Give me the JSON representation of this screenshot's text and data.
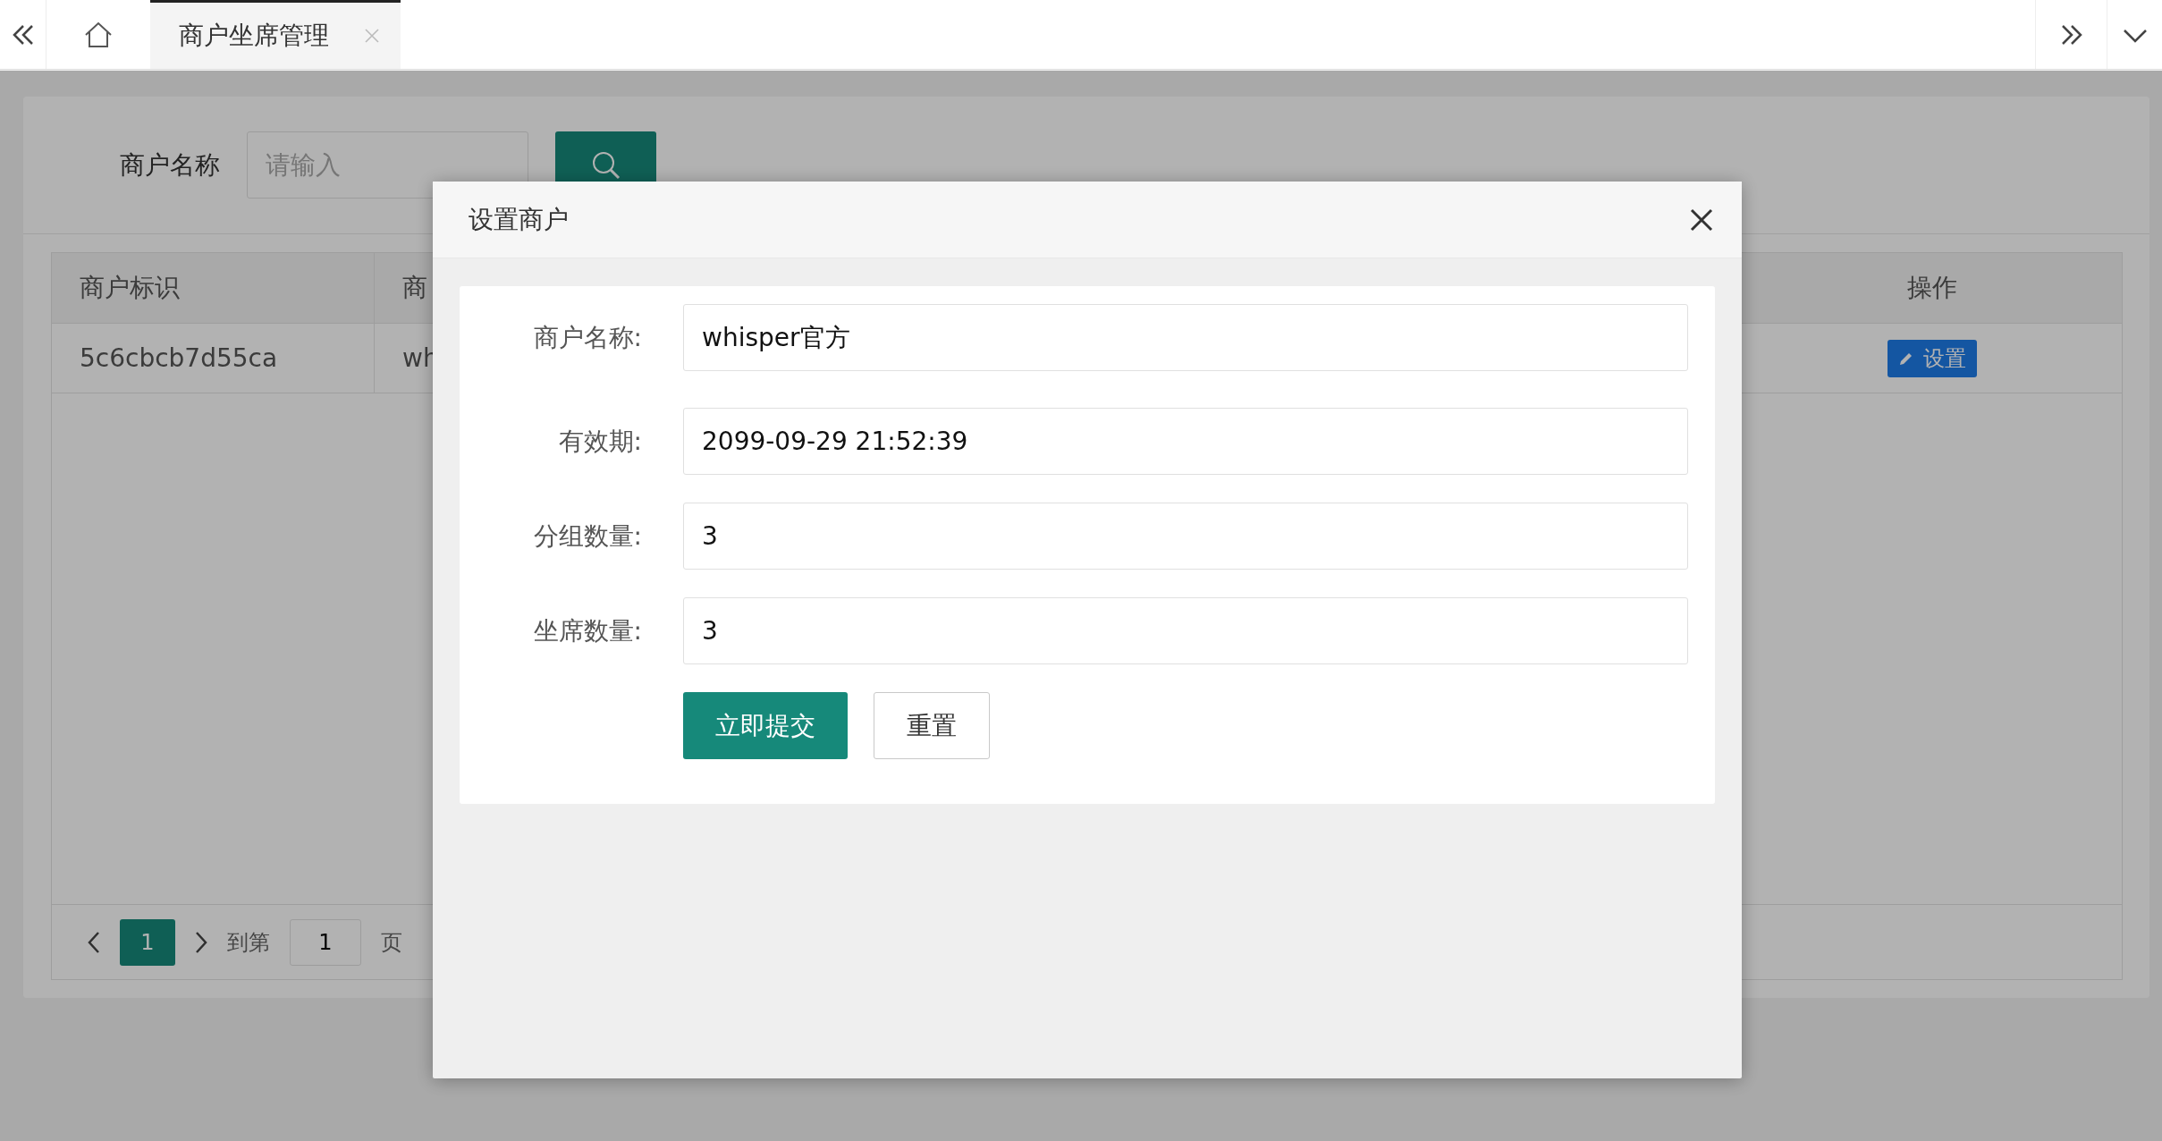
{
  "tab_bar": {
    "tabs": [
      {
        "label": "商户坐席管理",
        "selected": true
      }
    ]
  },
  "search": {
    "label": "商户名称",
    "placeholder": "请输入"
  },
  "table": {
    "columns": [
      "商户标识",
      "商"
    ],
    "action_column": "操作",
    "rows": [
      {
        "cells": [
          "5c6cbcb7d55ca",
          "wh"
        ],
        "action": "设置"
      }
    ]
  },
  "pagination": {
    "pages": [
      {
        "label": "1",
        "selected": true
      }
    ],
    "goto_label": "到第",
    "goto_value": "1",
    "page_unit": "页"
  },
  "modal": {
    "title": "设置商户",
    "fields": [
      {
        "label": "商户名称:",
        "value": "whisper官方"
      },
      {
        "label": "有效期:",
        "value": "2099-09-29 21:52:39"
      },
      {
        "label": "分组数量:",
        "value": "3"
      },
      {
        "label": "坐席数量:",
        "value": "3"
      }
    ],
    "buttons": [
      {
        "label": "立即提交",
        "kind": "primary"
      },
      {
        "label": "重置",
        "kind": "default"
      }
    ]
  }
}
